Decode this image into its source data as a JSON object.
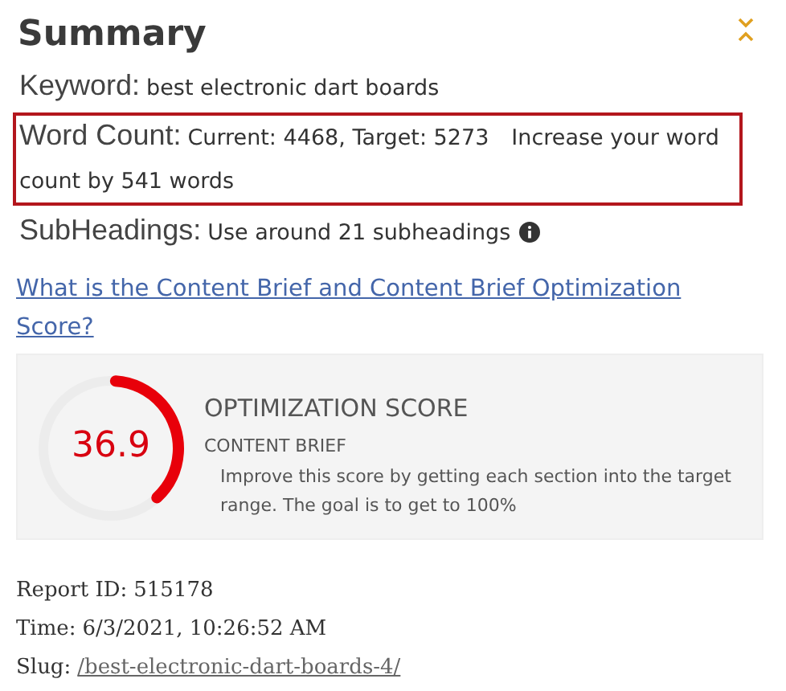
{
  "title": "Summary",
  "fields": [
    {
      "label": "Keyword:",
      "values": [
        "best electronic dart boards"
      ],
      "highlighted": false,
      "info": false
    },
    {
      "label": "Word Count:",
      "values": [
        "Current: 4468, Target: 5273",
        "Increase your word count by 541 words"
      ],
      "highlighted": true,
      "info": false
    },
    {
      "label": "SubHeadings:",
      "values": [
        "Use around 21 subheadings"
      ],
      "highlighted": false,
      "info": true
    }
  ],
  "help_link": "What is the Content Brief and Content Brief Optimization Score?",
  "score_card": {
    "score": "36.9",
    "level": 0.369,
    "title": "OPTIMIZATION SCORE",
    "subtitle": "CONTENT BRIEF",
    "description": "Improve this score by getting each section into the target range. The goal is to get to 100%"
  },
  "report": [
    {
      "label": "Report ID:",
      "value": "515178",
      "kind": "text"
    },
    {
      "label": "Time:",
      "value": "6/3/2021, 10:26:52 AM",
      "kind": "text"
    },
    {
      "label": "Slug:",
      "value": "/best-electronic-dart-boards-4/",
      "kind": "link"
    }
  ]
}
